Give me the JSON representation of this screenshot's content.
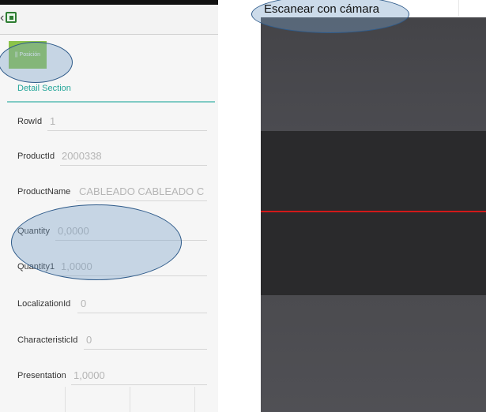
{
  "app": {
    "position_button_label": "|| Posición",
    "detail_section_title": "Detail Section"
  },
  "fields": [
    {
      "label": "RowId",
      "value": "1"
    },
    {
      "label": "ProductId",
      "value": "2000338"
    },
    {
      "label": "ProductName",
      "value": "CABLEADO CABLEADO C"
    },
    {
      "label": "Quantity",
      "value": "0,0000"
    },
    {
      "label": "Quantity1",
      "value": "1,0000"
    },
    {
      "label": "LocalizationId",
      "value": "0"
    },
    {
      "label": "CharacteristicId",
      "value": "0"
    },
    {
      "label": "Presentation",
      "value": "1,0000"
    }
  ],
  "camera": {
    "caption": "Escanear con cámara",
    "scan_line_color": "#d11919"
  },
  "colors": {
    "accent": "#26a69a",
    "button": "#8bc34a",
    "highlight": "#78a0c8"
  },
  "icons": {
    "back": "chevron-left-icon",
    "app": "app-logo-icon"
  }
}
